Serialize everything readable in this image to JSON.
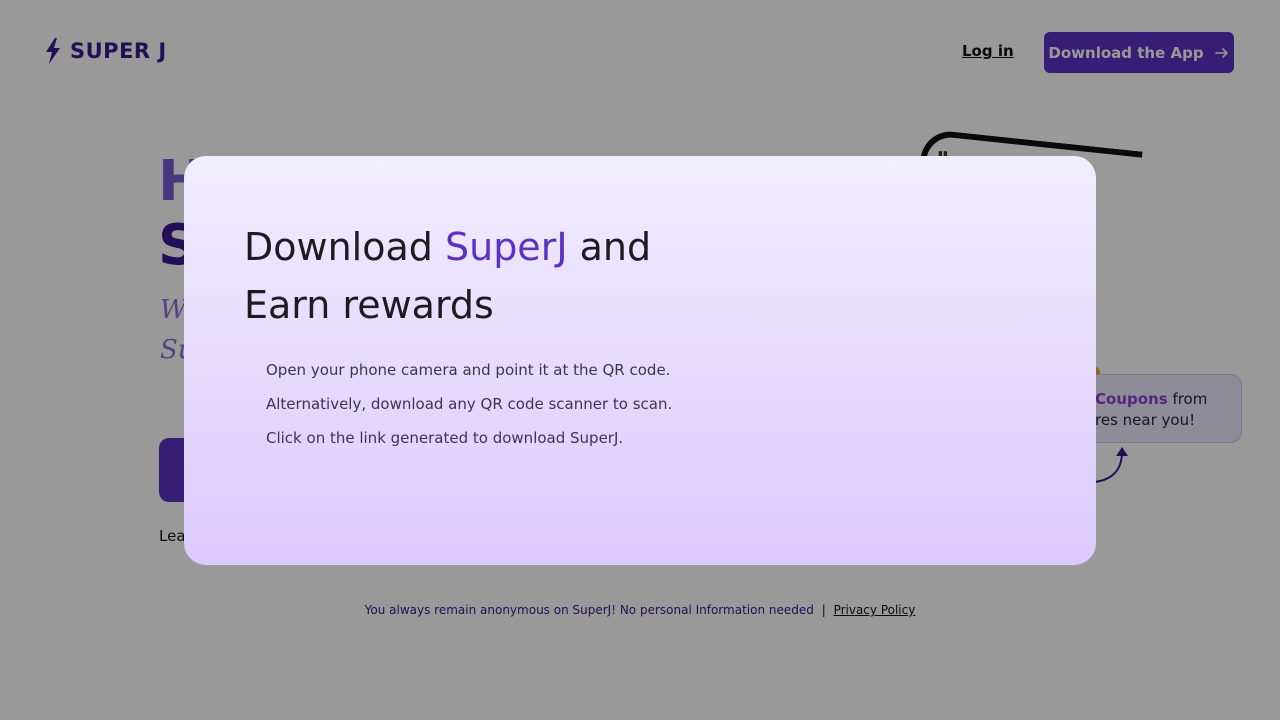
{
  "header": {
    "logo_text": "SUPER J",
    "login_label": "Log in",
    "download_label": "Download the App"
  },
  "hero": {
    "title_line1": "H",
    "title_line2": "S",
    "subtitle_line1": "Wh",
    "subtitle_line2": "Su",
    "learn_text": "Lea"
  },
  "coupon": {
    "highlight": "Coupons",
    "text_after": "from",
    "line2": "res near you!"
  },
  "footer": {
    "note": "You always remain anonymous on SuperJ! No personal Information needed",
    "separator": "|",
    "privacy_label": "Privacy Policy"
  },
  "modal": {
    "title_prefix": "Download",
    "title_brand": "SuperJ",
    "title_suffix": "and",
    "title_line2": "Earn rewards",
    "steps": [
      "Open your phone camera and point it at the QR code.",
      "Alternatively, download any QR code scanner to scan.",
      "Click on the link generated to download SuperJ."
    ]
  },
  "colors": {
    "brand": "#5b31c4",
    "brand_dark": "#3b1a8e",
    "overlay": "rgba(0,0,0,0.40)"
  },
  "icons": {
    "logo": "lightning-bolt-icon",
    "download_arrow": "arrow-right-icon",
    "coupon_pointer": "curved-arrow-icon"
  }
}
